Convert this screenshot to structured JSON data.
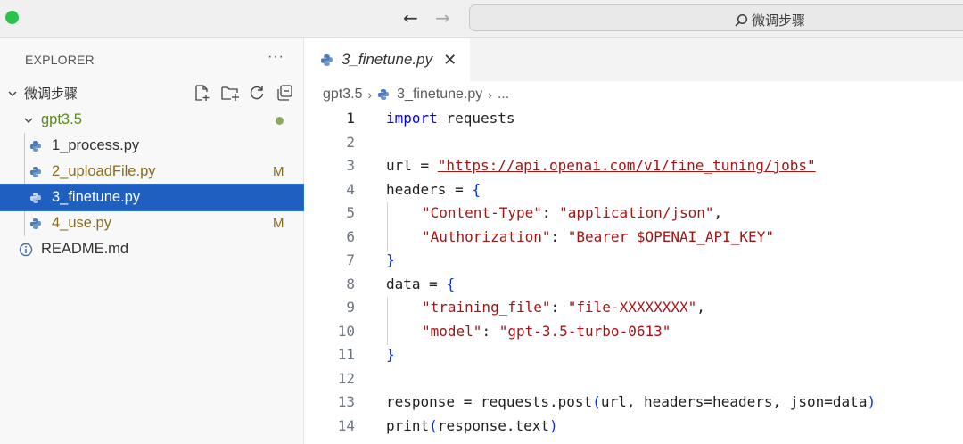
{
  "window": {
    "search_text": "微调步骤"
  },
  "sidebar": {
    "header": "EXPLORER",
    "more": "···",
    "root_folder": "微调步骤",
    "subfolder": "gpt3.5",
    "files": [
      {
        "name": "1_process.py",
        "badge": ""
      },
      {
        "name": "2_uploadFile.py",
        "badge": "M"
      },
      {
        "name": "3_finetune.py",
        "badge": ""
      },
      {
        "name": "4_use.py",
        "badge": "M"
      }
    ],
    "readme": "README.md"
  },
  "editor": {
    "tab_label": "3_finetune.py",
    "breadcrumb": {
      "folder": "gpt3.5",
      "file": "3_finetune.py",
      "rest": "..."
    },
    "line_numbers": [
      "1",
      "2",
      "3",
      "4",
      "5",
      "6",
      "7",
      "8",
      "9",
      "10",
      "11",
      "12",
      "13",
      "14"
    ],
    "code": {
      "l1_kw": "import",
      "l1_rest": " requests",
      "l3_var": "url = ",
      "l3_url": "\"https://api.openai.com/v1/fine_tuning/jobs\"",
      "l4": "headers = ",
      "l4_brace": "{",
      "l5_key": "\"Content-Type\"",
      "l5_sep": ": ",
      "l5_val": "\"application/json\"",
      "l5_end": ",",
      "l6_key": "\"Authorization\"",
      "l6_sep": ": ",
      "l6_val": "\"Bearer $OPENAI_API_KEY\"",
      "l7_brace": "}",
      "l8": "data = ",
      "l8_brace": "{",
      "l9_key": "\"training_file\"",
      "l9_sep": ": ",
      "l9_val": "\"file-XXXXXXXX\"",
      "l9_end": ",",
      "l10_key": "\"model\"",
      "l10_sep": ": ",
      "l10_val": "\"gpt-3.5-turbo-0613\"",
      "l11_brace": "}",
      "l13_a": "response = requests.post",
      "l13_open": "(",
      "l13_b": "url, headers=headers, json=data",
      "l13_close": ")",
      "l14_a": "print",
      "l14_open": "(",
      "l14_b": "response.text",
      "l14_close": ")"
    }
  },
  "colors": {
    "keyword": "#0000ff",
    "string": "#a31515",
    "selection": "#1f5fbf",
    "modified": "#8a6a1f",
    "folder_green": "#5b8a1f"
  },
  "icons": [
    "back-arrow-icon",
    "forward-arrow-icon",
    "search-icon",
    "chevron-down-icon",
    "new-file-icon",
    "new-folder-icon",
    "refresh-icon",
    "collapse-all-icon",
    "python-file-icon",
    "info-icon",
    "close-icon",
    "chevron-right-icon"
  ]
}
